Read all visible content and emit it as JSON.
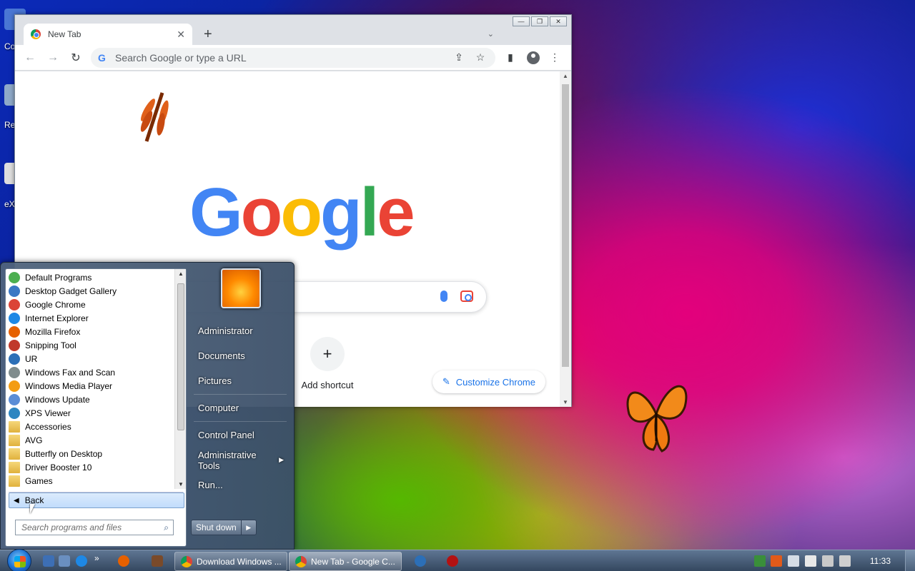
{
  "desktop": {
    "icons": [
      {
        "label": "Co",
        "color": "#4a77d4"
      },
      {
        "label": "Re",
        "color": "#8fa9c9"
      },
      {
        "label": "eX",
        "color": "#dedede"
      }
    ]
  },
  "browser": {
    "tab": {
      "title": "New Tab",
      "close": "✕"
    },
    "new_tab": "+",
    "tab_search": "⌄",
    "window_controls": {
      "minimize": "—",
      "restore": "❐",
      "close": "✕"
    },
    "toolbar": {
      "back": "←",
      "forward": "→",
      "reload": "↻",
      "omnibox_icon": "G",
      "omnibox_placeholder": "Search Google or type a URL",
      "share": "⇪",
      "bookmark": "☆",
      "sidepanel": "▮",
      "menu": "⋮"
    },
    "page": {
      "logo": [
        "G",
        "o",
        "o",
        "g",
        "l",
        "e"
      ],
      "shortcut_plus": "+",
      "shortcut_label": "Add shortcut",
      "customize_pen": "✎",
      "customize_label": "Customize Chrome"
    }
  },
  "startmenu": {
    "programs": [
      {
        "label": "Default Programs",
        "icon": "default-programs-icon",
        "color": "#4caf50"
      },
      {
        "label": "Desktop Gadget Gallery",
        "icon": "gadget-gallery-icon",
        "color": "#3b78c4"
      },
      {
        "label": "Google Chrome",
        "icon": "chrome-icon",
        "color": "#db4437"
      },
      {
        "label": "Internet Explorer",
        "icon": "internet-explorer-icon",
        "color": "#1e88e5"
      },
      {
        "label": "Mozilla Firefox",
        "icon": "firefox-icon",
        "color": "#e66000"
      },
      {
        "label": "Snipping Tool",
        "icon": "snipping-tool-icon",
        "color": "#c0392b"
      },
      {
        "label": "UR",
        "icon": "ur-browser-icon",
        "color": "#2c6fb7"
      },
      {
        "label": "Windows Fax and Scan",
        "icon": "fax-scan-icon",
        "color": "#7f8c8d"
      },
      {
        "label": "Windows Media Player",
        "icon": "media-player-icon",
        "color": "#f39c12"
      },
      {
        "label": "Windows Update",
        "icon": "windows-update-icon",
        "color": "#5b8dd6"
      },
      {
        "label": "XPS Viewer",
        "icon": "xps-viewer-icon",
        "color": "#2e86c1"
      },
      {
        "label": "Accessories",
        "icon": "folder-icon",
        "color": "#e6b84a"
      },
      {
        "label": "AVG",
        "icon": "folder-icon",
        "color": "#e6b84a"
      },
      {
        "label": "Butterfly on Desktop",
        "icon": "folder-icon",
        "color": "#e6b84a"
      },
      {
        "label": "Driver Booster 10",
        "icon": "folder-icon",
        "color": "#e6b84a"
      },
      {
        "label": "Games",
        "icon": "folder-icon",
        "color": "#e6b84a"
      }
    ],
    "back_label": "Back",
    "search_placeholder": "Search programs and files",
    "search_icon": "⌕",
    "right_links": [
      {
        "label": "Administrator"
      },
      {
        "label": "Documents"
      },
      {
        "label": "Pictures"
      },
      {
        "label": "Computer"
      },
      {
        "label": "Control Panel"
      },
      {
        "label": "Administrative Tools",
        "submenu": "▶"
      },
      {
        "label": "Run..."
      }
    ],
    "shutdown_label": "Shut down",
    "shutdown_options": "▶"
  },
  "taskbar": {
    "quicklaunch_more": "»",
    "tasks": [
      {
        "label": "Download Windows ..."
      },
      {
        "label": "New Tab - Google C..."
      }
    ],
    "clock": "11:33"
  }
}
